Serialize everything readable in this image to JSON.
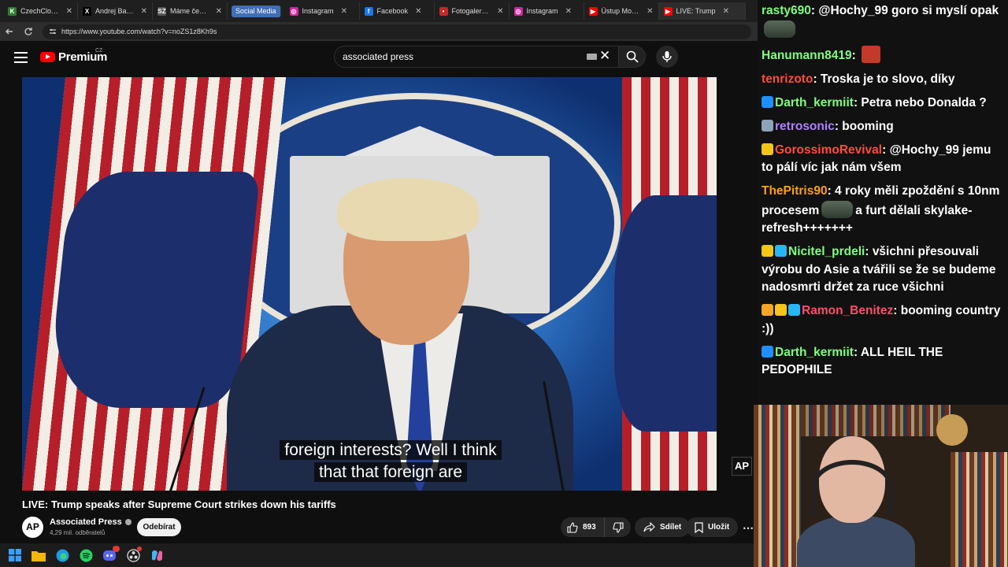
{
  "tabs": [
    {
      "label": "CzechCloud Stra",
      "color": "#2e7d32",
      "glyph": "K",
      "active": false
    },
    {
      "label": "Andrej Babiš na",
      "color": "#000000",
      "glyph": "X",
      "active": false
    },
    {
      "label": "Máme černé na",
      "color": "#555555",
      "glyph": "SZ",
      "active": false
    },
    {
      "label": "Social Media",
      "group": true
    },
    {
      "label": "Instagram",
      "color": "#d6249f",
      "glyph": "◎",
      "active": false
    },
    {
      "label": "Facebook",
      "color": "#1877f2",
      "glyph": "f",
      "active": false
    },
    {
      "label": "Fotogalerie: Pre:",
      "color": "#c62828",
      "glyph": "•",
      "active": false
    },
    {
      "label": "Instagram",
      "color": "#d6249f",
      "glyph": "◎",
      "active": false
    },
    {
      "label": "Ústup Motoristů",
      "color": "#ff0000",
      "glyph": "▶",
      "active": false
    },
    {
      "label": "LIVE: Trump",
      "color": "#ff0000",
      "glyph": "▶",
      "active": true
    }
  ],
  "address": {
    "url": "https://www.youtube.com/watch?v=noZS1z8Kh9s"
  },
  "youtube": {
    "logo_text": "Premium",
    "country": "CZ",
    "search_value": "associated press"
  },
  "video": {
    "subtitle_line1": "foreign interests? Well I think",
    "subtitle_line2": "that that foreign are",
    "watermark": "AP",
    "title": "LIVE: Trump speaks after Supreme Court strikes down his tariffs",
    "channel": "Associated Press",
    "channel_avatar": "AP",
    "subscribers": "4,29 mil. odběratelů",
    "subscribe_label": "Odebírat",
    "likes": "893",
    "share_label": "Sdílet",
    "save_label": "Uložit"
  },
  "chat": [
    {
      "user": "rasty690",
      "color": "#7fff7f",
      "badges": [],
      "text": "@Hochy_99 goro si myslí opak",
      "emote_after": true
    },
    {
      "user": "Hanumann8419",
      "color": "#7fff7f",
      "badges": [],
      "text": "",
      "emote_face": true
    },
    {
      "user": "tenrizoto",
      "color": "#ff4d3d",
      "badges": [],
      "text": "Troska je to slovo, díky"
    },
    {
      "user": "Darth_kermiit",
      "color": "#7fff7f",
      "badges": [
        "#1e90ff"
      ],
      "text": "Petra nebo Donalda ?"
    },
    {
      "user": "retrosonic",
      "color": "#b080ff",
      "badges": [
        "#8fa3b8"
      ],
      "text": "booming"
    },
    {
      "user": "GorossimoRevival",
      "color": "#ff4d3d",
      "badges": [
        "#f5c518"
      ],
      "text": "@Hochy_99 jemu to pálí víc jak nám všem"
    },
    {
      "user": "ThePitris90",
      "color": "#ff9f1a",
      "badges": [],
      "text": "4 roky měli zpoždění s 10nm procesem",
      "emote_mid": true,
      "text2": "a furt dělali skylake-refresh+++++++"
    },
    {
      "user": "Nicitel_prdeli",
      "color": "#7fff7f",
      "badges": [
        "#f5c518",
        "#29b6f6"
      ],
      "text": "všichni přesouvali výrobu do Asie a tvářili se že se budeme nadosmrti držet za ruce všichni"
    },
    {
      "user": "Ramon_Benitez",
      "color": "#ff4d6d",
      "badges": [
        "#f5a623",
        "#f5c518",
        "#29b6f6"
      ],
      "text": "booming country :))"
    },
    {
      "user": "Darth_kermiit",
      "color": "#7fff7f",
      "badges": [
        "#1e90ff"
      ],
      "text": "ALL HEIL THE PEDOPHILE"
    }
  ]
}
